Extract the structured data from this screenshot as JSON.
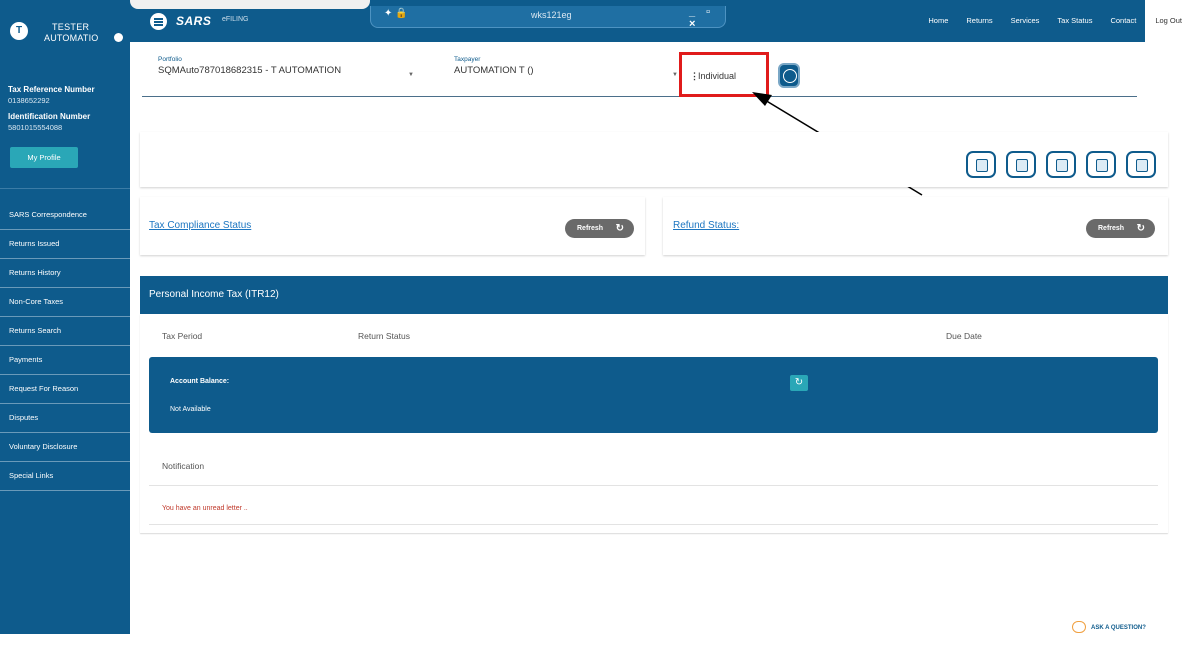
{
  "user": {
    "initial": "T",
    "first_name": "TESTER",
    "last_name": "AUTOMATIO",
    "tax_ref_label": "Tax Reference Number",
    "tax_ref_value": "0138652292",
    "id_label": "Identification Number",
    "id_value": "5801015554088",
    "profile_button": "My Profile"
  },
  "sidebar": {
    "items": [
      {
        "label": "SARS Correspondence"
      },
      {
        "label": "Returns Issued"
      },
      {
        "label": "Returns History"
      },
      {
        "label": "Non-Core Taxes"
      },
      {
        "label": "Returns Search"
      },
      {
        "label": "Payments"
      },
      {
        "label": "Request For Reason"
      },
      {
        "label": "Disputes"
      },
      {
        "label": "Voluntary Disclosure"
      },
      {
        "label": "Special Links"
      }
    ]
  },
  "header": {
    "logo": "SARS",
    "logo_sub": "eFILING",
    "remote_title": "wks121eg",
    "nav": [
      {
        "label": "Home"
      },
      {
        "label": "Returns"
      },
      {
        "label": "Services"
      },
      {
        "label": "Tax Status"
      },
      {
        "label": "Contact"
      },
      {
        "label": "Log Out"
      }
    ]
  },
  "selectors": {
    "portfolio_label": "Portfolio",
    "portfolio_value": "SQMAuto787018682315 - T AUTOMATION",
    "taxpayer_label": "Taxpayer",
    "taxpayer_value": "AUTOMATION T ()",
    "type_value": "Individual"
  },
  "status": {
    "compliance_link": "Tax Compliance Status",
    "refund_link": "Refund Status:",
    "refresh_label": "Refresh"
  },
  "pit": {
    "title": "Personal Income Tax (ITR12)",
    "col_tax_period": "Tax Period",
    "col_return_status": "Return Status",
    "col_due_date": "Due Date",
    "balance_label": "Account Balance:",
    "balance_value": "Not Available",
    "notification_title": "Notification",
    "notification_message": "You have an unread letter .."
  },
  "footer": {
    "ask_question": "ASK A QUESTION?"
  },
  "colors": {
    "primary": "#0e5b8c",
    "accent": "#2aa7b7",
    "highlight": "#e01b1b"
  }
}
